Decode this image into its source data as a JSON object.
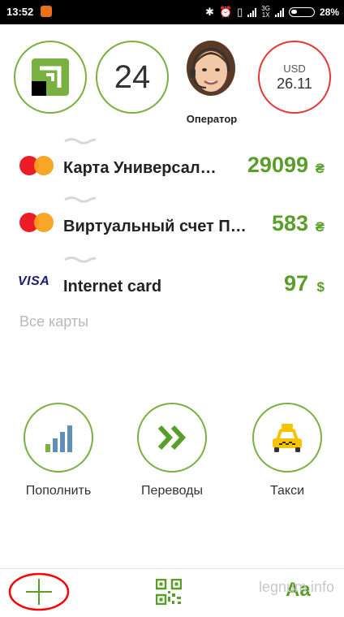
{
  "status_bar": {
    "time": "13:52",
    "network": [
      "3G",
      "1X"
    ],
    "battery_percent": "28%",
    "battery_level": 0.28
  },
  "header": {
    "notifications_count": "24",
    "operator_label": "Оператор",
    "currency": {
      "code": "USD",
      "rate": "26.11"
    }
  },
  "cards": [
    {
      "brand": "mastercard",
      "name": "Карта Универсал…",
      "amount": "29099",
      "currency": "₴"
    },
    {
      "brand": "mastercard",
      "name": "Виртуальный счет П…",
      "amount": "583",
      "currency": "₴"
    },
    {
      "brand": "visa",
      "brand_label": "VISA",
      "name": "Internet card",
      "amount": "97",
      "currency": "$"
    }
  ],
  "all_cards_label": "Все карты",
  "actions": [
    {
      "label": "Пополнить",
      "icon": "signal-bars-icon"
    },
    {
      "label": "Переводы",
      "icon": "double-chevron-right-icon"
    },
    {
      "label": "Такси",
      "icon": "taxi-icon"
    }
  ],
  "bottom_nav": {
    "add_icon": "plus-icon",
    "qr_icon": "qr-code-icon",
    "font_label": "Aa",
    "watermark": "legnum.info"
  },
  "colors": {
    "brand_green": "#79b041",
    "amount_green": "#5a9e2a",
    "usd_red": "#e53935",
    "annotation_red": "#ff0000"
  }
}
